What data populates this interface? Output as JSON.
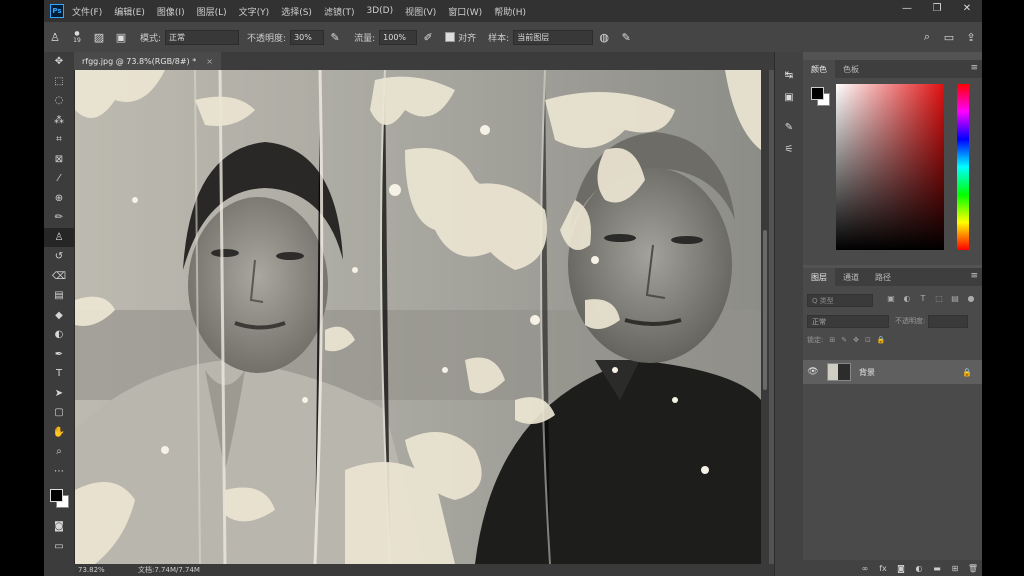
{
  "app": {
    "logo_text": "Ps"
  },
  "menu": [
    "文件(F)",
    "编辑(E)",
    "图像(I)",
    "图层(L)",
    "文字(Y)",
    "选择(S)",
    "滤镜(T)",
    "3D(D)",
    "视图(V)",
    "窗口(W)",
    "帮助(H)"
  ],
  "window_controls": {
    "minimize": "—",
    "restore": "❐",
    "close": "✕"
  },
  "options": {
    "brush_size": "19",
    "mode_label": "模式:",
    "mode_value": "正常",
    "opacity_label": "不透明度:",
    "opacity_value": "30%",
    "flow_label": "流量:",
    "flow_value": "100%",
    "aligned_label": "对齐",
    "sample_label": "样本:",
    "sample_value": "当前图层"
  },
  "document": {
    "tab_title": "rfgg.jpg @ 73.8%(RGB/8#) *",
    "tab_close": "×"
  },
  "status": {
    "zoom": "73.82%",
    "doc_size": "文档:7.74M/7.74M"
  },
  "color_panel": {
    "tabs": [
      "颜色",
      "色板"
    ],
    "menu": "≡"
  },
  "layers_panel": {
    "tabs": [
      "图层",
      "通道",
      "路径"
    ],
    "search_placeholder": "Q 类型",
    "blend_mode": "正常",
    "opacity_label": "不透明度:",
    "lock_label": "锁定:",
    "layer_name": "背景"
  },
  "colors": {
    "accent": "#31a8ff",
    "ui_dark": "#323232",
    "ui_mid": "#535353"
  }
}
